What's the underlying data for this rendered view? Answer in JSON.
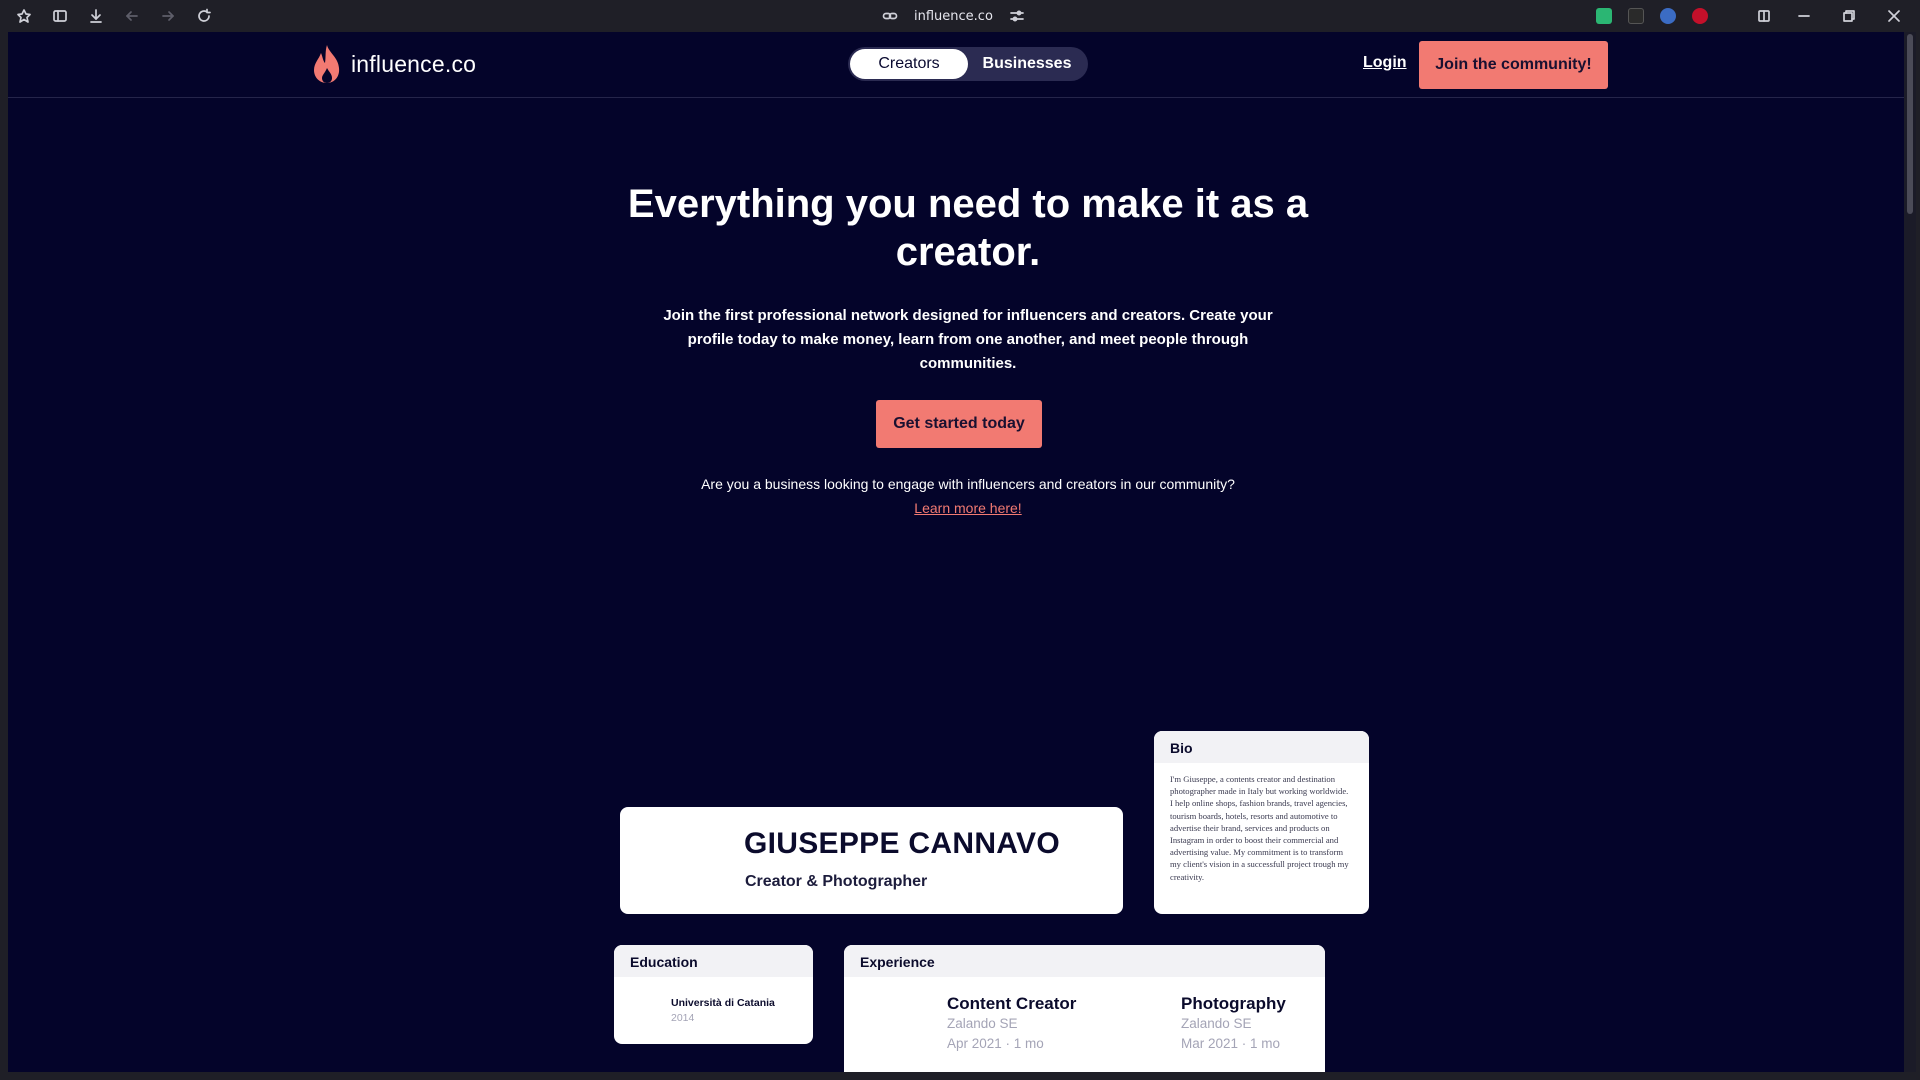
{
  "browser": {
    "url": "influence.co",
    "icons": [
      "menu-icon",
      "sidebar-icon",
      "download-icon",
      "back-icon",
      "forward-icon",
      "reload-icon",
      "link-icon",
      "tune-icon",
      "split-view-icon",
      "minimize-icon",
      "maximize-icon",
      "close-icon"
    ],
    "extension_colors": [
      "#2bb673",
      "#2a2a2a",
      "#3b6cc4",
      "#c4102a"
    ]
  },
  "header": {
    "logo_text": "influence.co",
    "segment": {
      "creators": "Creators",
      "businesses": "Businesses",
      "selected": "Creators"
    },
    "login": "Login",
    "join": "Join the community!"
  },
  "hero": {
    "title": "Everything you need to make it as a creator.",
    "subtitle": "Join the first professional network designed for influencers and creators. Create your profile today to make money, learn from one another, and meet people through communities.",
    "cta": "Get started today",
    "business_question": "Are you a business looking to engage with influencers and creators in our community?",
    "learn_more": "Learn more here!"
  },
  "profile": {
    "name": "GIUSEPPE CANNAVO",
    "role": "Creator & Photographer",
    "bio_title": "Bio",
    "bio": "I'm Giuseppe, a contents creator and destination photographer made in Italy but working worldwide. I help online shops, fashion brands, travel agencies, tourism boards, hotels, resorts and automotive to advertise their brand, services and products on Instagram in order to boost their commercial and advertising value. My commitment is to transform my client's vision in a successfull project trough my creativity.",
    "education_title": "Education",
    "education": {
      "school": "Università di Catania",
      "year": "2014"
    },
    "experience_title": "Experience",
    "experience": [
      {
        "title": "Content Creator",
        "company": "Zalando SE",
        "period": "Apr 2021 · 1 mo"
      },
      {
        "title": "Photography",
        "company": "Zalando SE",
        "period": "Mar 2021 · 1 mo"
      }
    ]
  },
  "colors": {
    "page_bg": "#04042a",
    "accent": "#f27a72",
    "card_bg": "#ffffff"
  }
}
